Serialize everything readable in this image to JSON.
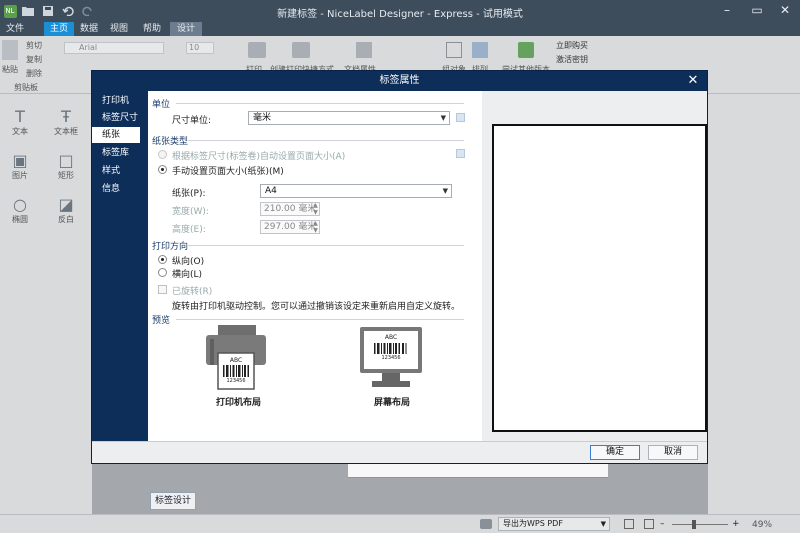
{
  "app": {
    "title": "新建标签 - NiceLabel Designer - Express - 试用模式",
    "tabs": [
      {
        "label": "文件"
      },
      {
        "label": "主页"
      },
      {
        "label": "数据"
      },
      {
        "label": "视图"
      },
      {
        "label": "帮助"
      },
      {
        "label": "设计"
      }
    ],
    "active_tab": "主页"
  },
  "ribbon": {
    "clipboard": {
      "paste": "粘贴",
      "cut": "剪切",
      "copy": "复制",
      "delete": "删除",
      "group": "剪贴板"
    },
    "font_name": "Arial",
    "font_size": "10",
    "print": "打印",
    "create_print_shortcut": "创建打印快捷方式",
    "doc_properties": "文档属性",
    "group_objects": "组对象",
    "arrange": "排列",
    "try_other_versions": "尝试其他版本",
    "buy_now": "立即购买",
    "activate_key": "激活密钥"
  },
  "toolbox": {
    "items": [
      {
        "label": "文本",
        "icon": "text-icon"
      },
      {
        "label": "文本框",
        "icon": "textbox-icon"
      },
      {
        "label": "图片",
        "icon": "picture-icon"
      },
      {
        "label": "矩形",
        "icon": "rectangle-icon"
      },
      {
        "label": "椭圆",
        "icon": "ellipse-icon"
      },
      {
        "label": "反白",
        "icon": "inverse-icon"
      }
    ]
  },
  "bottom": {
    "design_tab": "标签设计",
    "printer": "导出为WPS PDF",
    "zoom": "49%"
  },
  "dialog": {
    "title": "标签属性",
    "close": "✕",
    "nav": [
      "打印机",
      "标签尺寸",
      "纸张",
      "标签库",
      "样式",
      "信息"
    ],
    "selected_nav": "纸张",
    "units": {
      "section": "单位",
      "label": "尺寸单位:",
      "value": "毫米"
    },
    "paper_type": {
      "section": "纸张类型",
      "auto_option": "根据标签尺寸(标签卷)自动设置页面大小(A)",
      "manual_option": "手动设置页面大小(纸张)(M)",
      "selected": "manual",
      "paper_label": "纸张(P):",
      "paper_value": "A4",
      "width_label": "宽度(W):",
      "width_value": "210.00 毫米",
      "height_label": "高度(E):",
      "height_value": "297.00 毫米"
    },
    "orientation": {
      "section": "打印方向",
      "portrait": "纵向(O)",
      "landscape": "横向(L)",
      "selected": "portrait",
      "rotated_label": "已旋转(R)",
      "rotated_checked": false,
      "note": "旋转由打印机驱动控制。您可以通过撤销该设定来重新启用自定义旋转。"
    },
    "preview": {
      "section": "预览",
      "printer_layout": "打印机布局",
      "screen_layout": "屏幕布局",
      "sample_text": "ABC",
      "sample_number": "123456"
    },
    "ok": "确定",
    "cancel": "取消"
  },
  "colors": {
    "titlebar": "#3e4d5c",
    "active_tab": "#1b8fd6",
    "dialog_frame": "#0e2e5a",
    "ribbon": "#d8dadc"
  }
}
